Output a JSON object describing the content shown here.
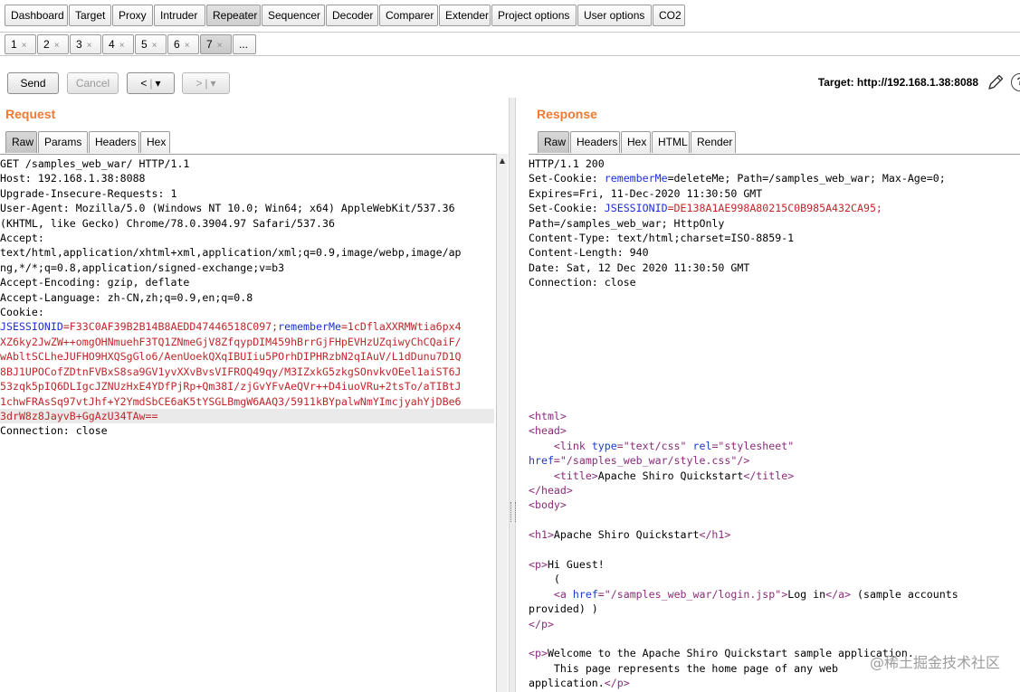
{
  "top_tabs": [
    "Dashboard",
    "Target",
    "Proxy",
    "Intruder",
    "Repeater",
    "Sequencer",
    "Decoder",
    "Comparer",
    "Extender",
    "Project options",
    "User options",
    "CO2"
  ],
  "active_top_tab": "Repeater",
  "sub_tabs": [
    "1",
    "2",
    "3",
    "4",
    "5",
    "6",
    "7"
  ],
  "sub_tab_more": "...",
  "sub_tab_close": "×",
  "active_sub_tab": "7",
  "toolbar": {
    "send": "Send",
    "cancel": "Cancel",
    "back_glyph": "<",
    "forward_glyph": ">",
    "dropdown_glyph": "▾",
    "target": "Target: http://192.168.1.38:8088",
    "help": "?"
  },
  "request": {
    "title": "Request",
    "tabs": [
      "Raw",
      "Params",
      "Headers",
      "Hex"
    ],
    "active_tab": "Raw",
    "lines": [
      "GET /samples_web_war/ HTTP/1.1",
      "Host: 192.168.1.38:8088",
      "Upgrade-Insecure-Requests: 1",
      "User-Agent: Mozilla/5.0 (Windows NT 10.0; Win64; x64) AppleWebKit/537.36",
      "(KHTML, like Gecko) Chrome/78.0.3904.97 Safari/537.36",
      "Accept:",
      "text/html,application/xhtml+xml,application/xml;q=0.9,image/webp,image/ap",
      "ng,*/*;q=0.8,application/signed-exchange;v=b3",
      "Accept-Encoding: gzip, deflate",
      "Accept-Language: zh-CN,zh;q=0.9,en;q=0.8",
      "Cookie:"
    ],
    "cookie_line": {
      "name1": "JSESSIONID",
      "value1": "=F33C0AF39B2B14B8AEDD47446518C097;",
      "name2": "rememberMe",
      "value2": "=1cDflaXXRMWtia6px4"
    },
    "cookie_continuation": [
      "XZ6ky2JwZW++omgOHNmuehF3TQ1ZNmeGjV8ZfqypDIM459hBrrGjFHpEVHzUZqiwyChCQaiF/",
      "wAbltSCLheJUFHO9HXQSgGlo6/AenUoekQXqIBUIiu5POrhDIPHRzbN2qIAuV/L1dDunu7D1Q",
      "8BJ1UPOCofZDtnFVBxS8sa9GV1yvXXvBvsVIFROQ49qy/M3IZxkG5zkgSOnvkvOEel1aiST6J",
      "53zqk5pIQ6DLIgcJZNUzHxE4YDfPjRp+Qm38I/zjGvYFvAeQVr++D4iuoVRu+2tsTo/aTIBtJ",
      "1chwFRAsSq97vtJhf+Y2YmdSbCE6aK5tYSGLBmgW6AAQ3/5911kBYpalwNmYImcjyahYjDBe6"
    ],
    "cookie_last": "3drW8z8JayvB+GgAzU34TAw==",
    "connection": "Connection: close"
  },
  "response": {
    "title": "Response",
    "tabs": [
      "Raw",
      "Headers",
      "Hex",
      "HTML",
      "Render"
    ],
    "active_tab": "Raw",
    "status_line": "HTTP/1.1 200",
    "set_cookie_1": {
      "prefix": "Set-Cookie: ",
      "name": "rememberMe",
      "rest": "=deleteMe; Path=/samples_web_war; Max-Age=0;"
    },
    "expires": "Expires=Fri, 11-Dec-2020 11:30:50 GMT",
    "set_cookie_2": {
      "prefix": "Set-Cookie: ",
      "name": "JSESSIONID",
      "rest": "=DE138A1AE998A80215C0B985A432CA95;"
    },
    "path": "Path=/samples_web_war; HttpOnly",
    "content_type": "Content-Type: text/html;charset=ISO-8859-1",
    "content_length": "Content-Length: 940",
    "date": "Date: Sat, 12 Dec 2020 11:30:50 GMT",
    "connection": "Connection: close",
    "html_title": "Apache Shiro Quickstart",
    "css_href": "/samples_web_war/style.css",
    "login_href": "/samples_web_war/login.jsp",
    "hi_guest": "Hi Guest!",
    "log_in": "Log in",
    "sample_accounts": " (sample accounts",
    "provided": "provided) )",
    "welcome": "Welcome to the Apache Shiro Quickstart sample application.",
    "home_page_line": "    This page represents the home page of any web",
    "application": "application."
  },
  "watermark": "@稀土掘金技术社区"
}
